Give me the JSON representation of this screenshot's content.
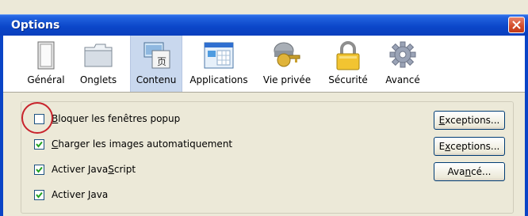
{
  "window": {
    "title": "Options"
  },
  "toolbar": {
    "items": [
      {
        "label": "Général",
        "icon": "general-icon"
      },
      {
        "label": "Onglets",
        "icon": "tabs-icon"
      },
      {
        "label": "Contenu",
        "icon": "content-icon",
        "selected": true
      },
      {
        "label": "Applications",
        "icon": "applications-icon"
      },
      {
        "label": "Vie privée",
        "icon": "privacy-icon"
      },
      {
        "label": "Sécurité",
        "icon": "padlock-icon"
      },
      {
        "label": "Avancé",
        "icon": "gear-icon"
      }
    ]
  },
  "options": [
    {
      "pre": "",
      "u": "B",
      "post": "loquer les fenêtres popup",
      "checked": false
    },
    {
      "pre": "",
      "u": "C",
      "post": "harger les images automatiquement",
      "checked": true
    },
    {
      "pre": "Activer Java",
      "u": "S",
      "post": "cript",
      "checked": true
    },
    {
      "pre": "Activer ",
      "u": "J",
      "post": "ava",
      "checked": true
    }
  ],
  "buttons": {
    "exceptions1": {
      "u": "E",
      "post": "xceptions..."
    },
    "exceptions2": {
      "pre": "E",
      "u": "x",
      "post": "ceptions..."
    },
    "advanced": {
      "pre": "Ava",
      "u": "n",
      "post": "cé..."
    }
  },
  "colors": {
    "titlebar": "#0a46c9",
    "selected_tab": "#c9d8ee",
    "highlight_circle": "#c8232c"
  }
}
